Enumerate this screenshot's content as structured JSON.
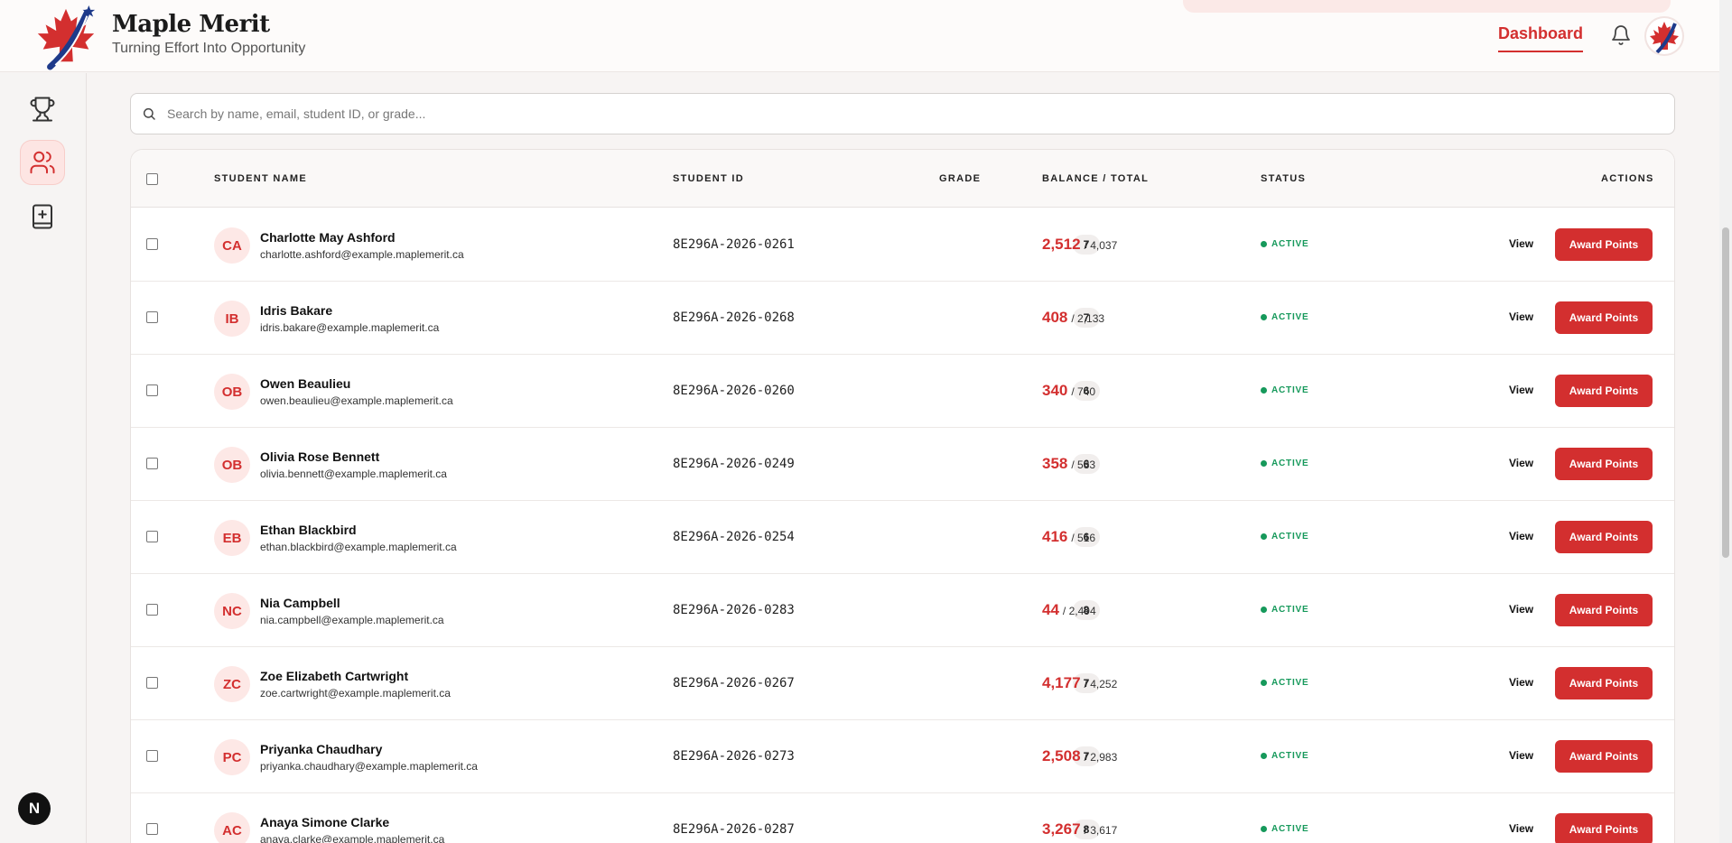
{
  "brand": {
    "title": "Maple Merit",
    "tagline": "Turning Effort Into Opportunity"
  },
  "header": {
    "nav_dashboard": "Dashboard"
  },
  "colors": {
    "accent": "#d32f2f",
    "active": "#16995b",
    "avatar_bg": "#fde8e6"
  },
  "sidebar": {
    "items": [
      {
        "icon": "trophy-icon",
        "active": false
      },
      {
        "icon": "users-icon",
        "active": true
      },
      {
        "icon": "add-book-icon",
        "active": false
      }
    ]
  },
  "footer_badge": "N",
  "search": {
    "placeholder": "Search by name, email, student ID, or grade..."
  },
  "table": {
    "columns": {
      "name": "STUDENT NAME",
      "id": "STUDENT ID",
      "grade": "GRADE",
      "balance": "BALANCE / TOTAL",
      "status": "STATUS",
      "actions": "ACTIONS"
    },
    "view_label": "View",
    "award_label": "Award Points",
    "rows": [
      {
        "initials": "CA",
        "name": "Charlotte May Ashford",
        "email": "charlotte.ashford@example.maplemerit.ca",
        "student_id": "8E296A-2026-0261",
        "grade": "7",
        "balance": "2,512",
        "total": "/ 4,037",
        "status": "ACTIVE"
      },
      {
        "initials": "IB",
        "name": "Idris Bakare",
        "email": "idris.bakare@example.maplemerit.ca",
        "student_id": "8E296A-2026-0268",
        "grade": "7",
        "balance": "408",
        "total": "/ 2,133",
        "status": "ACTIVE"
      },
      {
        "initials": "OB",
        "name": "Owen Beaulieu",
        "email": "owen.beaulieu@example.maplemerit.ca",
        "student_id": "8E296A-2026-0260",
        "grade": "6",
        "balance": "340",
        "total": "/ 740",
        "status": "ACTIVE"
      },
      {
        "initials": "OB",
        "name": "Olivia Rose Bennett",
        "email": "olivia.bennett@example.maplemerit.ca",
        "student_id": "8E296A-2026-0249",
        "grade": "6",
        "balance": "358",
        "total": "/ 533",
        "status": "ACTIVE"
      },
      {
        "initials": "EB",
        "name": "Ethan Blackbird",
        "email": "ethan.blackbird@example.maplemerit.ca",
        "student_id": "8E296A-2026-0254",
        "grade": "6",
        "balance": "416",
        "total": "/ 516",
        "status": "ACTIVE"
      },
      {
        "initials": "NC",
        "name": "Nia Campbell",
        "email": "nia.campbell@example.maplemerit.ca",
        "student_id": "8E296A-2026-0283",
        "grade": "8",
        "balance": "44",
        "total": "/ 2,494",
        "status": "ACTIVE"
      },
      {
        "initials": "ZC",
        "name": "Zoe Elizabeth Cartwright",
        "email": "zoe.cartwright@example.maplemerit.ca",
        "student_id": "8E296A-2026-0267",
        "grade": "7",
        "balance": "4,177",
        "total": "/ 4,252",
        "status": "ACTIVE"
      },
      {
        "initials": "PC",
        "name": "Priyanka Chaudhary",
        "email": "priyanka.chaudhary@example.maplemerit.ca",
        "student_id": "8E296A-2026-0273",
        "grade": "7",
        "balance": "2,508",
        "total": "/ 2,983",
        "status": "ACTIVE"
      },
      {
        "initials": "AC",
        "name": "Anaya Simone Clarke",
        "email": "anaya.clarke@example.maplemerit.ca",
        "student_id": "8E296A-2026-0287",
        "grade": "8",
        "balance": "3,267",
        "total": "/ 3,617",
        "status": "ACTIVE"
      }
    ]
  }
}
